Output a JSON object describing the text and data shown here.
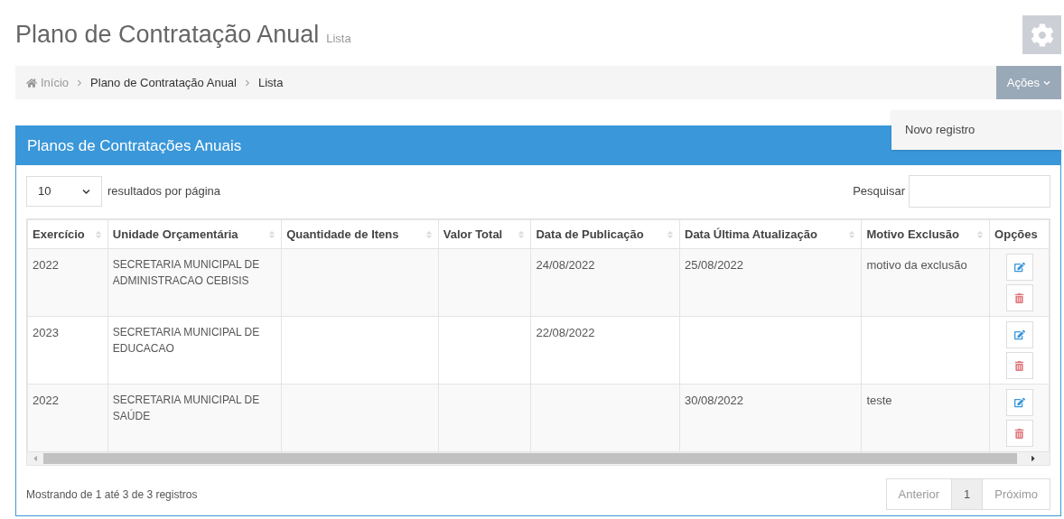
{
  "page": {
    "title": "Plano de Contratação Anual",
    "subtitle": "Lista"
  },
  "breadcrumb": [
    {
      "label": "Início",
      "kind": "home"
    },
    {
      "label": "Plano de Contratação Anual",
      "kind": "link"
    },
    {
      "label": "Lista",
      "kind": "current"
    }
  ],
  "actions": {
    "label": "Ações",
    "expanded": true,
    "menu": [
      "Novo registro"
    ]
  },
  "panel": {
    "title": "Planos de Contratações Anuais"
  },
  "page_size": {
    "value": "10",
    "label": "resultados por página"
  },
  "search": {
    "label": "Pesquisar"
  },
  "table": {
    "columns": [
      {
        "label": "Exercício",
        "sortable": true
      },
      {
        "label": "Unidade Orçamentária",
        "sortable": true
      },
      {
        "label": "Quantidade de Itens",
        "sortable": true
      },
      {
        "label": "Valor Total",
        "sortable": true
      },
      {
        "label": "Data de Publicação",
        "sortable": true
      },
      {
        "label": "Data Última Atualização",
        "sortable": true
      },
      {
        "label": "Motivo Exclusão",
        "sortable": true
      },
      {
        "label": "Opções",
        "sortable": false
      }
    ],
    "rows": [
      {
        "cells": [
          "2022",
          "SECRETARIA MUNICIPAL DE ADMINISTRACAO CEBISIS",
          "",
          "",
          "24/08/2022",
          "25/08/2022",
          "motivo da exclusão"
        ]
      },
      {
        "cells": [
          "2023",
          "SECRETARIA MUNICIPAL DE EDUCACAO",
          "",
          "",
          "22/08/2022",
          "",
          ""
        ]
      },
      {
        "cells": [
          "2022",
          "SECRETARIA MUNICIPAL DE SAÚDE",
          "",
          "",
          "",
          "30/08/2022",
          "teste"
        ]
      }
    ]
  },
  "footer": {
    "info": "Mostrando de 1 até 3 de 3 registros",
    "pagination": [
      {
        "label": "Anterior",
        "selected": false
      },
      {
        "label": "1",
        "selected": true
      },
      {
        "label": "Próximo",
        "selected": false
      }
    ]
  }
}
